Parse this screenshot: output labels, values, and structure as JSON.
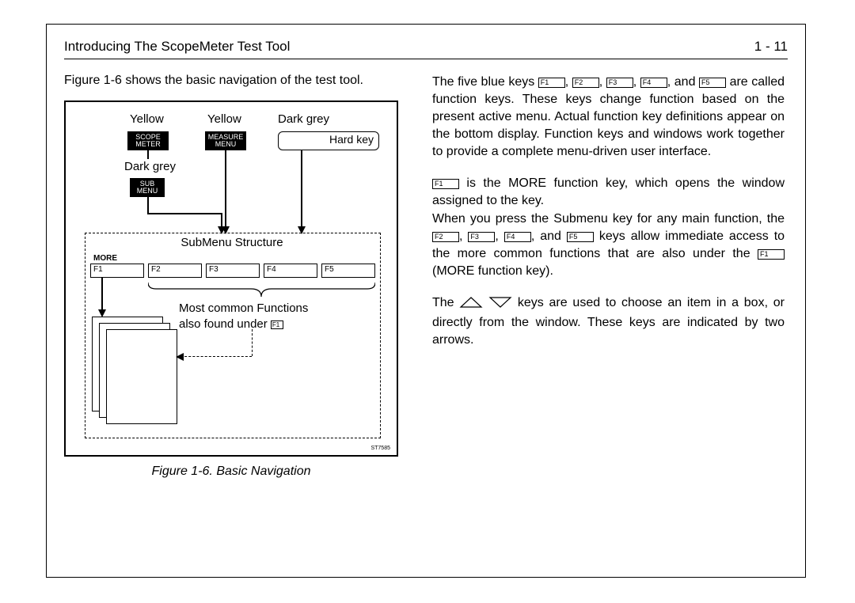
{
  "header": {
    "title": "Introducing The ScopeMeter Test Tool",
    "page": "1 - 11"
  },
  "left": {
    "intro": "Figure 1-6 shows the basic navigation of the test tool.",
    "caption": "Figure 1-6.   Basic Navigation"
  },
  "fig": {
    "yellow1": "Yellow",
    "yellow2": "Yellow",
    "darkgrey1": "Dark grey",
    "darkgrey2": "Dark grey",
    "scope": "SCOPE\nMETER",
    "measure": "MEASURE\nMENU",
    "submenu": "SUB\nMENU",
    "hardkey": "Hard key",
    "submenu_struct": "SubMenu Structure",
    "more": "MORE",
    "f1": "F1",
    "f2": "F2",
    "f3": "F3",
    "f4": "F4",
    "f5": "F5",
    "common_line1": "Most common Functions",
    "common_line2_a": "also found under ",
    "common_f": "F1",
    "st": "ST7585"
  },
  "right": {
    "p1a": "The five blue keys ",
    "p1b": ", ",
    "p1c": ", ",
    "p1d": ", ",
    "p1e": ", and ",
    "p1f": " are called function keys. These keys change function based on the present active menu. Actual function key definitions appear on the bottom display. Function keys and windows work together to provide a complete menu-driven user interface.",
    "p2a": " is the MORE function key, which opens the window assigned to the key.",
    "p2b": "When you press the Submenu key for any main function, the ",
    "p2c": ", ",
    "p2d": ", ",
    "p2e": ", and ",
    "p2f": " keys allow immediate access to the more common functions that are also under the ",
    "p2g": " (MORE function key).",
    "p3a": "The ",
    "p3b": " keys are used to choose an item in a box, or directly from the window. These keys are indicated by two arrows.",
    "k": {
      "f1": "F1",
      "f2": "F2",
      "f3": "F3",
      "f4": "F4",
      "f5": "F5"
    }
  }
}
